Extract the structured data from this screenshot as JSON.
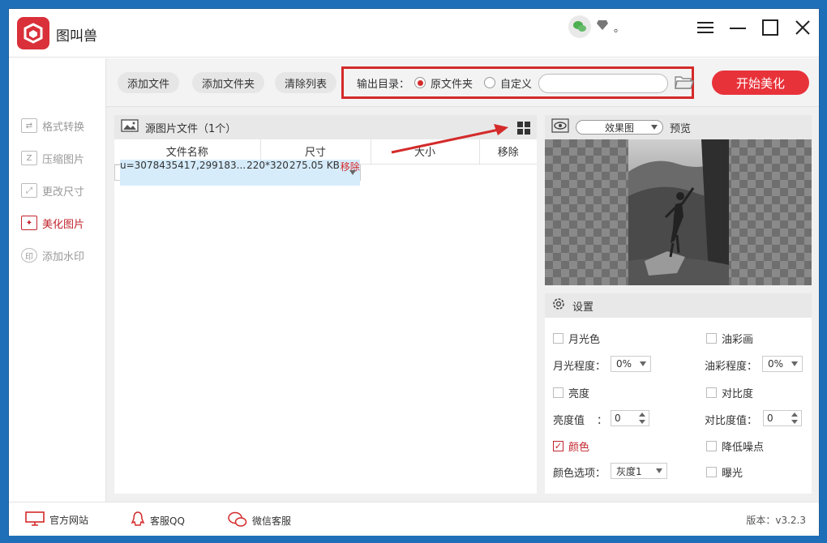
{
  "app": {
    "title": "图叫兽"
  },
  "titlebar": {
    "dot": "。"
  },
  "sidebar": {
    "items": [
      {
        "label": "格式转换",
        "icon": "convert-icon"
      },
      {
        "label": "压缩图片",
        "icon": "compress-icon"
      },
      {
        "label": "更改尺寸",
        "icon": "resize-icon"
      },
      {
        "label": "美化图片",
        "icon": "beautify-icon",
        "active": true
      },
      {
        "label": "添加水印",
        "icon": "watermark-icon"
      }
    ]
  },
  "toolbar": {
    "add_file": "添加文件",
    "add_folder": "添加文件夹",
    "clear_list": "清除列表",
    "output_label": "输出目录：",
    "opt_source": "原文件夹",
    "opt_custom": "自定义",
    "path_value": "",
    "start": "开始美化"
  },
  "files": {
    "header": "源图片文件（1个）",
    "columns": [
      "文件名称",
      "尺寸",
      "大小",
      "移除"
    ],
    "rows": [
      {
        "name": "u=3078435417,299183...",
        "size": "220*320",
        "filesize": "275.05 KB",
        "remove": "移除"
      }
    ]
  },
  "preview": {
    "select_value": "效果图",
    "label": "预览"
  },
  "settings": {
    "title": "设置",
    "moonlight": "月光色",
    "oil": "油彩画",
    "moon_degree_label": "月光程度：",
    "moon_degree_value": "0%",
    "oil_degree_label": "油彩程度：",
    "oil_degree_value": "0%",
    "brightness": "亮度",
    "contrast": "对比度",
    "brightness_value_label": "亮度值",
    "brightness_colon": "：",
    "brightness_value": "0",
    "contrast_value_label": "对比度值：",
    "contrast_value": "0",
    "color": "颜色",
    "denoise": "降低噪点",
    "color_option_label": "颜色选项：",
    "color_option_value": "灰度1",
    "exposure": "曝光"
  },
  "footer": {
    "website": "官方网站",
    "qq": "客服QQ",
    "wechat": "微信客服",
    "version": "版本：v3.2.3"
  },
  "colors": {
    "accent": "#e8323a",
    "selection": "#d6ecfb",
    "annotation": "#d42a2a"
  }
}
